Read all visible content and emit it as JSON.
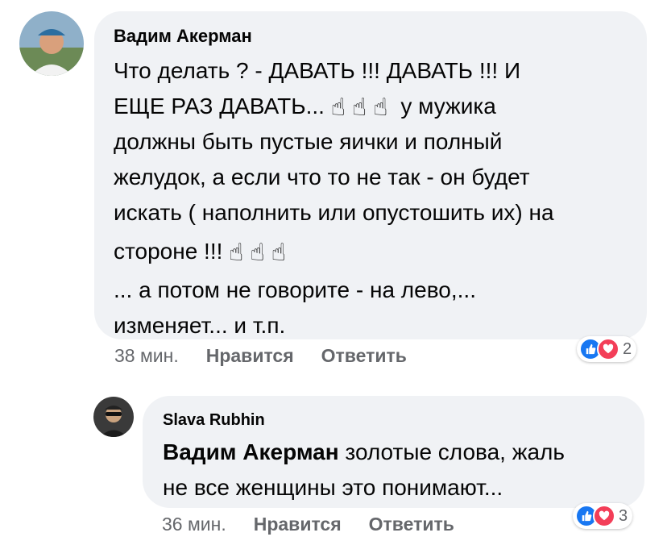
{
  "comment1": {
    "author": "Вадим Акерман",
    "lines": [
      "Что делать ? - ДАВАТЬ !!! ДАВАТЬ !!! И",
      "ЕЩЕ  РАЗ ДАВАТЬ...",
      "у мужика",
      "должны быть пустые яички и полный",
      "желудок, а если что то не так - он будет",
      "искать ( наполнить или опустошить их) на",
      "стороне !!!",
      "... а потом не говорите - на лево,...",
      "изменяет... и т.п."
    ],
    "emoji": "☝",
    "time": "38 мин.",
    "like_label": "Нравится",
    "reply_label": "Ответить",
    "reaction_count": "2"
  },
  "comment2": {
    "author": "Slava Rubhin",
    "mention": "Вадим Акерман",
    "text_line1": " золотые слова, жаль",
    "text_line2": "не все женщины это понимают...",
    "time": "36 мин.",
    "like_label": "Нравится",
    "reply_label": "Ответить",
    "reaction_count": "3"
  },
  "colors": {
    "bubble": "#f0f2f5",
    "like": "#1877f2",
    "love": "#f33e58",
    "secondary_text": "#65676b"
  },
  "icons": [
    "thumbs-up-icon",
    "heart-icon",
    "pointing-up-emoji"
  ]
}
